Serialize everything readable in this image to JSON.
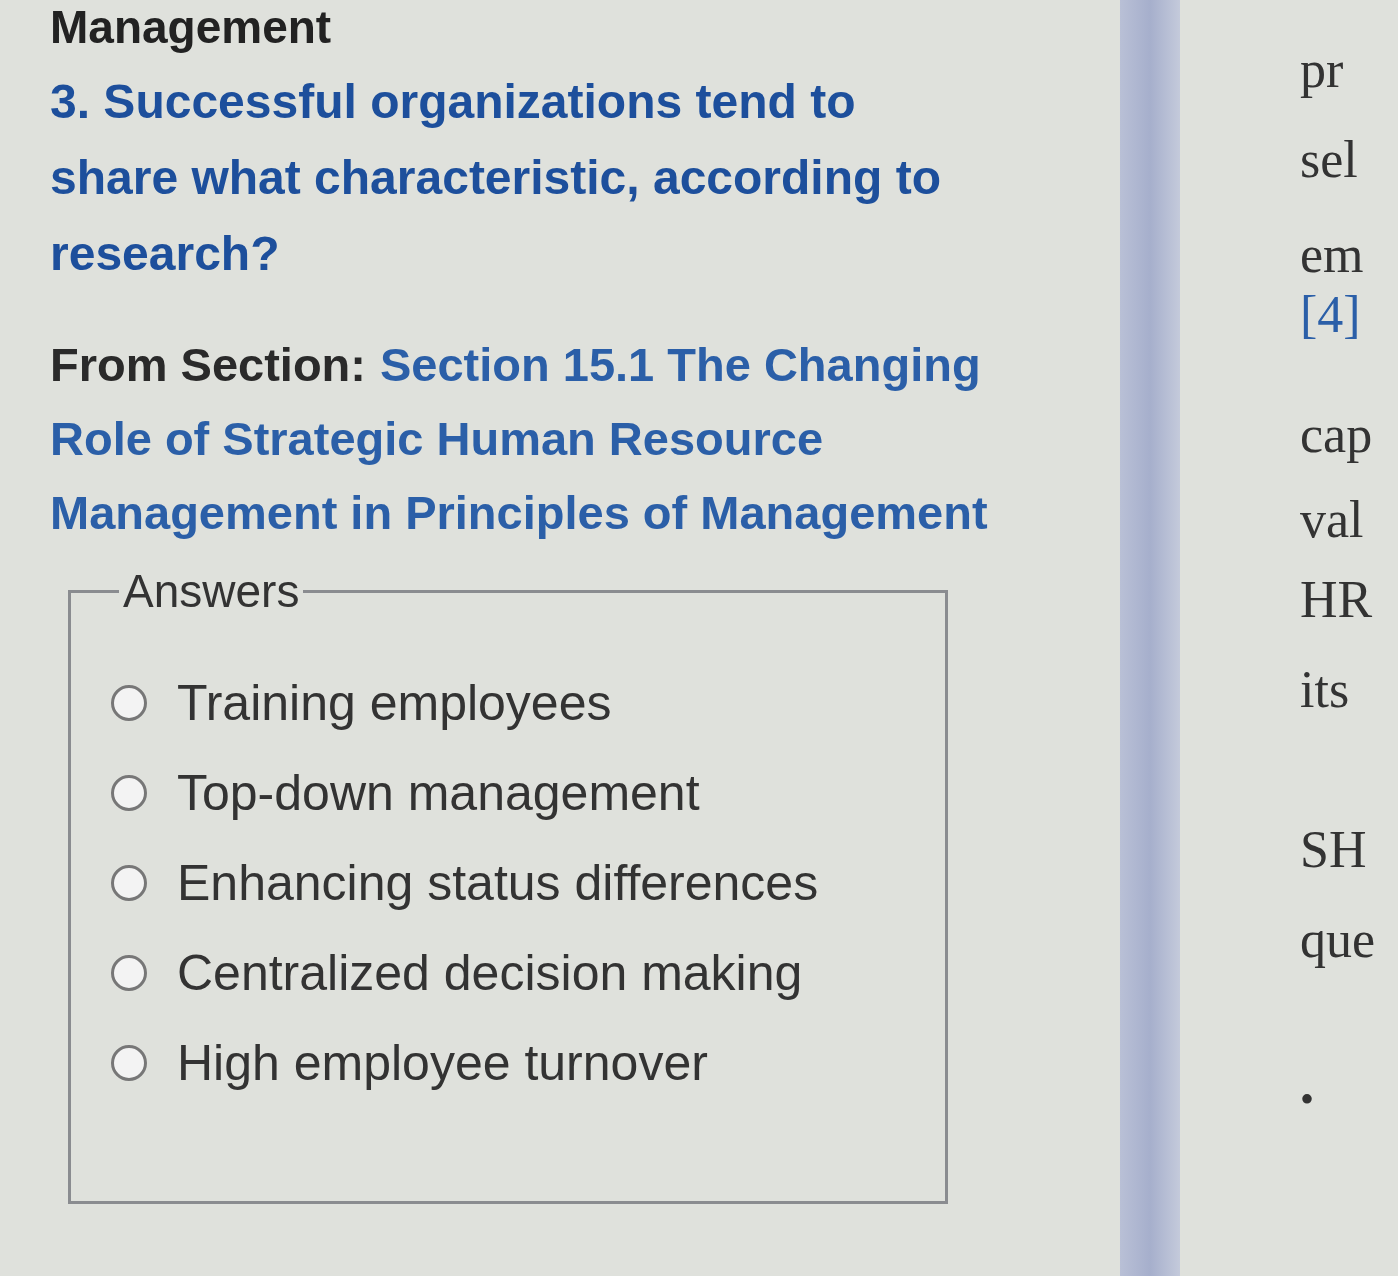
{
  "heading": "Management",
  "question": "3. Successful organizations tend to share what characteristic, according to research?",
  "source": {
    "label": "From Section:",
    "link_lines": [
      "Section 15.1 The Changing",
      "Role of Strategic Human Resource",
      "Management in Principles of Management"
    ]
  },
  "answers": {
    "legend": "Answers",
    "options": [
      {
        "label": "Training employees",
        "selected": false
      },
      {
        "label": "Top-down management",
        "selected": false
      },
      {
        "label": "Enhancing status differences",
        "selected": false
      },
      {
        "label": "Centralized decision making",
        "selected": false
      },
      {
        "label": "High employee turnover",
        "selected": false
      }
    ]
  },
  "side_text": [
    {
      "kind": "text",
      "text": "pr"
    },
    {
      "kind": "text",
      "text": "sel"
    },
    {
      "kind": "text",
      "text": "em"
    },
    {
      "kind": "link",
      "text": "[4]"
    },
    {
      "kind": "text",
      "text": "cap"
    },
    {
      "kind": "text",
      "text": "val"
    },
    {
      "kind": "text",
      "text": "HR"
    },
    {
      "kind": "text",
      "text": "its"
    },
    {
      "kind": "text",
      "text": "SH"
    },
    {
      "kind": "text",
      "text": "que"
    },
    {
      "kind": "bullet",
      "text": "•"
    }
  ]
}
